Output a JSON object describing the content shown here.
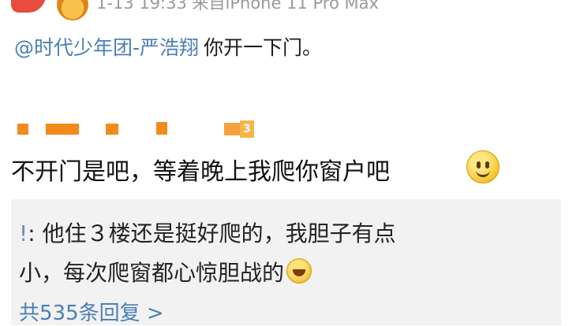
{
  "post": {
    "meta": "1-13 19:33  来自iPhone 11 Pro Max",
    "mention": "@时代少年团-严浩翔",
    "message": "你开一下门。"
  },
  "comment": {
    "level_badge": "3",
    "text": "不开门是吧，等着晚上我爬你窗户吧",
    "emoji": "smile-emoji"
  },
  "reply": {
    "author_mark": "!",
    "line1": ": 他住３楼还是挺好爬的，我胆子有点",
    "line2": "小，每次爬窗都心惊胆战的",
    "emoji": "laugh-cry-emoji",
    "more": "共535条回复 >"
  },
  "colors": {
    "link": "#4a7fb8",
    "redaction": "#f28a1c",
    "reply_bg": "#f2f2f2"
  }
}
